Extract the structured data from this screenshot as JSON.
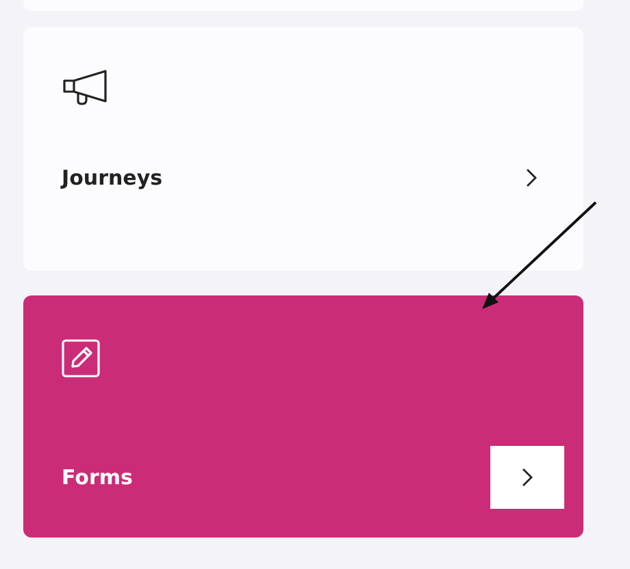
{
  "cards": [
    {
      "kind": "megaphone",
      "label": "Journeys",
      "selected": false
    },
    {
      "kind": "pencil",
      "label": "Forms",
      "selected": true
    }
  ]
}
